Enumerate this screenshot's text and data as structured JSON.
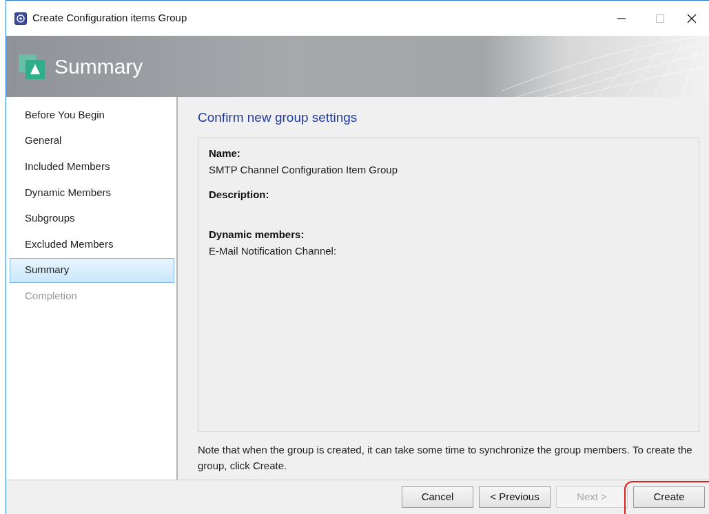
{
  "window": {
    "title": "Create Configuration items Group"
  },
  "header": {
    "title": "Summary"
  },
  "sidebar": {
    "items": [
      {
        "label": "Before You Begin",
        "selected": false,
        "disabled": false
      },
      {
        "label": "General",
        "selected": false,
        "disabled": false
      },
      {
        "label": "Included Members",
        "selected": false,
        "disabled": false
      },
      {
        "label": "Dynamic Members",
        "selected": false,
        "disabled": false
      },
      {
        "label": "Subgroups",
        "selected": false,
        "disabled": false
      },
      {
        "label": "Excluded Members",
        "selected": false,
        "disabled": false
      },
      {
        "label": "Summary",
        "selected": true,
        "disabled": false
      },
      {
        "label": "Completion",
        "selected": false,
        "disabled": true
      }
    ]
  },
  "content": {
    "heading": "Confirm new group settings",
    "fields": [
      {
        "label": "Name:",
        "value": "SMTP Channel Configuration Item Group"
      },
      {
        "label": "Description:"
      },
      {
        "label": "Dynamic members:",
        "value": "E-Mail Notification Channel:"
      }
    ],
    "note": "Note that when the group is created, it can take some time to synchronize the group members. To create the group, click Create."
  },
  "buttons": [
    {
      "label": "Cancel",
      "disabled": false,
      "highlighted": false
    },
    {
      "label": "< Previous",
      "disabled": false,
      "highlighted": false
    },
    {
      "label": "Next >",
      "disabled": true,
      "highlighted": false
    },
    {
      "label": "Create",
      "disabled": false,
      "highlighted": true
    }
  ]
}
